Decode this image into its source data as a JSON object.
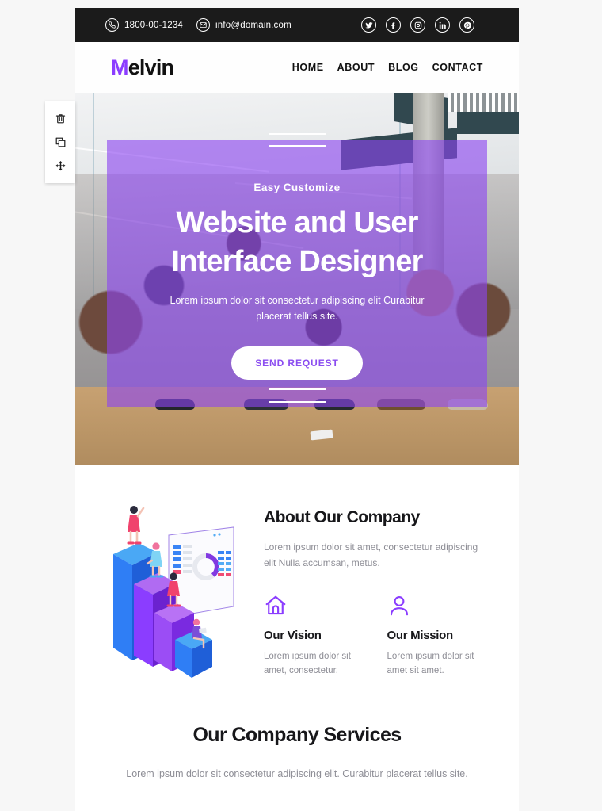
{
  "topbar": {
    "phone": "1800-00-1234",
    "phone_icon": "phone-circle-icon",
    "email": "info@domain.com",
    "email_icon": "envelope-circle-icon",
    "socials": [
      {
        "name": "twitter",
        "glyph": "🐦"
      },
      {
        "name": "facebook",
        "glyph": "f"
      },
      {
        "name": "instagram",
        "glyph": "▣"
      },
      {
        "name": "linkedin",
        "glyph": "in"
      },
      {
        "name": "pinterest",
        "glyph": "𝑃"
      }
    ]
  },
  "header": {
    "logo_first": "M",
    "logo_rest": "elvin",
    "nav": [
      {
        "label": "HOME"
      },
      {
        "label": "ABOUT"
      },
      {
        "label": "BLOG"
      },
      {
        "label": "CONTACT"
      }
    ]
  },
  "hero": {
    "eyebrow": "Easy Customize",
    "title_line1": "Website and User",
    "title_line2": "Interface Designer",
    "subtitle": "Lorem ipsum dolor sit consectetur adipiscing elit Curabitur placerat tellus site.",
    "button_label": "SEND REQUEST",
    "overlay_color": "#8c46f0",
    "button_text_color": "#8b4df0"
  },
  "about": {
    "title": "About Our Company",
    "paragraph": "Lorem ipsum dolor sit amet, consectetur adipiscing elit Nulla accumsan, metus.",
    "illustration_name": "isometric-bar-chart-people-illustration",
    "features": [
      {
        "icon": "home-icon",
        "title": "Our Vision",
        "text": "Lorem ipsum dolor sit amet, consectetur."
      },
      {
        "icon": "user-icon",
        "title": "Our Mission",
        "text": "Lorem ipsum dolor sit amet sit amet."
      }
    ]
  },
  "services": {
    "title": "Our Company Services",
    "subtitle": "Lorem ipsum dolor sit consectetur adipiscing elit. Curabitur placerat tellus site."
  },
  "editor_toolbar": {
    "tools": [
      {
        "name": "delete",
        "icon": "trash-icon"
      },
      {
        "name": "duplicate",
        "icon": "copy-icon"
      },
      {
        "name": "move",
        "icon": "move-arrows-icon"
      }
    ]
  },
  "theme": {
    "accent": "#8b3dff",
    "topbar_bg": "#1b1b1b",
    "page_bg": "#ffffff",
    "canvas_bg": "#f7f7f7",
    "muted_text": "#8e8e96"
  }
}
